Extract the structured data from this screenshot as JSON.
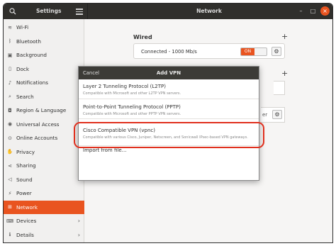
{
  "titlebar": {
    "app_title": "Settings",
    "panel_title": "Network",
    "controls": {
      "minimize": "–",
      "maximize": "□",
      "close": "×"
    }
  },
  "sidebar": {
    "items": [
      {
        "label": "Wi-Fi",
        "icon": "wifi-icon",
        "glyph": "≋"
      },
      {
        "label": "Bluetooth",
        "icon": "bluetooth-icon",
        "glyph": "ᛒ"
      },
      {
        "label": "Background",
        "icon": "background-icon",
        "glyph": "▣"
      },
      {
        "label": "Dock",
        "icon": "dock-icon",
        "glyph": "▯"
      },
      {
        "label": "Notifications",
        "icon": "bell-icon",
        "glyph": "♪"
      },
      {
        "label": "Search",
        "icon": "search-icon",
        "glyph": "⌕"
      },
      {
        "label": "Region & Language",
        "icon": "camera-icon",
        "glyph": "◘"
      },
      {
        "label": "Universal Access",
        "icon": "accessibility-icon",
        "glyph": "◉"
      },
      {
        "label": "Online Accounts",
        "icon": "accounts-icon",
        "glyph": "⊙"
      },
      {
        "label": "Privacy",
        "icon": "hand-icon",
        "glyph": "✋"
      },
      {
        "label": "Sharing",
        "icon": "sharing-icon",
        "glyph": "⋖"
      },
      {
        "label": "Sound",
        "icon": "speaker-icon",
        "glyph": "◁"
      },
      {
        "label": "Power",
        "icon": "power-icon",
        "glyph": "⚡"
      },
      {
        "label": "Network",
        "icon": "network-icon",
        "glyph": "⊞",
        "active": true
      },
      {
        "label": "Devices",
        "icon": "devices-icon",
        "glyph": "⌨",
        "chevron": "›"
      },
      {
        "label": "Details",
        "icon": "info-icon",
        "glyph": "ℹ",
        "chevron": "›"
      }
    ]
  },
  "network": {
    "wired_title": "Wired",
    "add_symbol": "+",
    "wired_status": "Connected - 1000 Mb/s",
    "toggle_label": "ON",
    "partial_text": "er"
  },
  "dialog": {
    "cancel_label": "Cancel",
    "title": "Add VPN",
    "options": [
      {
        "title": "Layer 2 Tunneling Protocol (L2TP)",
        "subtitle": "Compatible with Microsoft and other L2TP VPN servers."
      },
      {
        "title": "Point-to-Point Tunneling Protocol (PPTP)",
        "subtitle": "Compatible with Microsoft and other PPTP VPN servers."
      },
      {
        "title": "Cisco Compatible VPN (vpnc)",
        "subtitle": "Compatible with various Cisco, Juniper, Netscreen, and Sonicwall IPsec-based VPN gateways."
      },
      {
        "title": "Import from file…",
        "subtitle": ""
      }
    ]
  },
  "colors": {
    "accent": "#e95420",
    "highlight": "#e0301e",
    "titlebar": "#302f2c"
  }
}
